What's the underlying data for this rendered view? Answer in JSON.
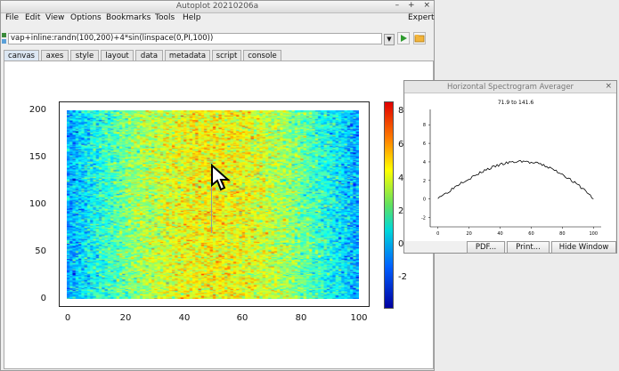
{
  "window": {
    "title": "Autoplot 20210206a",
    "controls": [
      "–",
      "+",
      "×"
    ]
  },
  "menubar": {
    "items": [
      "File",
      "Edit",
      "View",
      "Options",
      "Bookmarks",
      "Tools",
      "Help"
    ],
    "expert": "Expert"
  },
  "uri": {
    "value": "vap+inline:randn(100,200)+4*sin(linspace(0,PI,100))"
  },
  "tabs": [
    "canvas",
    "axes",
    "style",
    "layout",
    "data",
    "metadata",
    "script",
    "console"
  ],
  "active_tab": "canvas",
  "spectrogram": {
    "yticks": [
      "200",
      "150",
      "100",
      "50",
      "0"
    ],
    "xticks": [
      "0",
      "20",
      "40",
      "60",
      "80",
      "100"
    ],
    "colorbar_ticks": [
      "8",
      "6",
      "4",
      "2",
      "0",
      "-2"
    ]
  },
  "popup": {
    "title": "Horizontal Spectrogram Averager",
    "close": "×",
    "plot_title": "71.9 to 141.6",
    "buttons": {
      "pdf": "PDF...",
      "print": "Print...",
      "hide": "Hide Window"
    }
  },
  "chart_data": [
    {
      "type": "heatmap",
      "title": "",
      "xlabel": "",
      "ylabel": "",
      "xlim": [
        0,
        100
      ],
      "ylim": [
        0,
        200
      ],
      "x_ticks": [
        0,
        20,
        40,
        60,
        80,
        100
      ],
      "y_ticks": [
        0,
        50,
        100,
        150,
        200
      ],
      "color_range": [
        -3.5,
        8.5
      ],
      "colorbar_ticks": [
        8,
        6,
        4,
        2,
        0,
        -2
      ],
      "z_formula": "randn(100,200)+4*sin(linspace(0,PI,100))"
    },
    {
      "type": "line",
      "title": "71.9 to 141.6",
      "x_ticks": [
        0,
        20,
        40,
        60,
        80,
        100
      ],
      "y_ticks": [
        8,
        6,
        4,
        2,
        0,
        -2
      ],
      "xlim": [
        -5,
        105
      ],
      "ylim": [
        -3,
        8.5
      ],
      "x": [
        0,
        5,
        10,
        15,
        20,
        25,
        30,
        35,
        40,
        45,
        50,
        55,
        60,
        65,
        70,
        75,
        80,
        85,
        90,
        95,
        100
      ],
      "y": [
        0.2,
        0.6,
        1.2,
        1.8,
        2.2,
        2.6,
        3.1,
        3.4,
        3.7,
        3.9,
        4.0,
        4.1,
        3.9,
        3.8,
        3.5,
        3.1,
        2.7,
        2.1,
        1.5,
        0.9,
        0.0
      ]
    }
  ]
}
